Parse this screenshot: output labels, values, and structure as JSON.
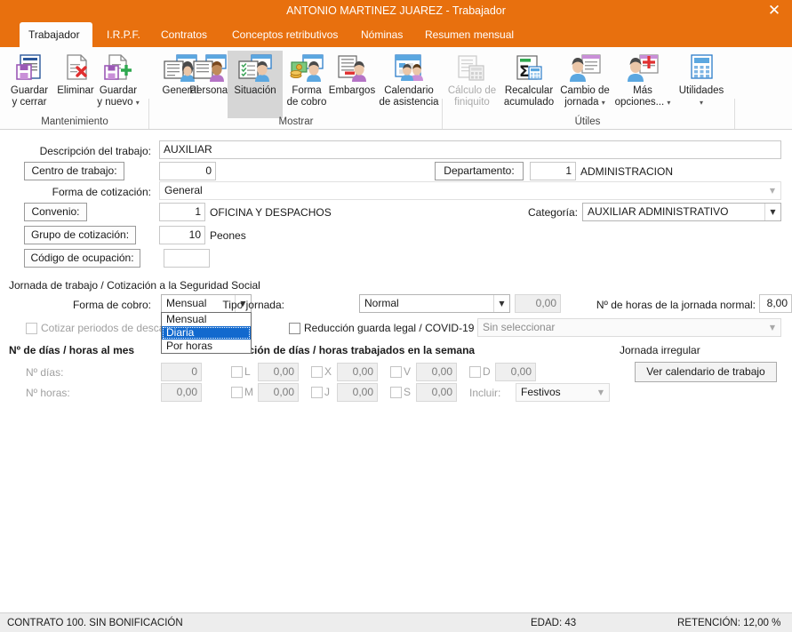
{
  "window": {
    "title": "ANTONIO MARTINEZ JUAREZ - Trabajador",
    "close_icon": "close-icon",
    "accent_color": "#E8700E"
  },
  "tabs": [
    {
      "label": "Trabajador",
      "active": true
    },
    {
      "label": "I.R.P.F.",
      "active": false
    },
    {
      "label": "Contratos",
      "active": false
    },
    {
      "label": "Conceptos retributivos",
      "active": false
    },
    {
      "label": "Nóminas",
      "active": false
    },
    {
      "label": "Resumen mensual",
      "active": false
    }
  ],
  "ribbon": {
    "groups": [
      {
        "label": "Mantenimiento"
      },
      {
        "label": "Mostrar"
      },
      {
        "label": "Útiles"
      }
    ],
    "buttons": [
      {
        "label": "Guardar\ny cerrar",
        "icon": "save-close-icon",
        "selected": false,
        "disabled": false,
        "caret": false
      },
      {
        "label": "Eliminar",
        "icon": "delete-document-icon",
        "selected": false,
        "disabled": false,
        "caret": false
      },
      {
        "label": "Guardar\ny nuevo",
        "icon": "save-new-icon",
        "selected": false,
        "disabled": false,
        "caret": true
      },
      {
        "label": "General",
        "icon": "person-general-icon",
        "selected": false,
        "disabled": false,
        "caret": false
      },
      {
        "label": "Personal",
        "icon": "person-personal-icon",
        "selected": false,
        "disabled": false,
        "caret": false
      },
      {
        "label": "Situación",
        "icon": "person-status-icon",
        "selected": true,
        "disabled": false,
        "caret": false
      },
      {
        "label": "Forma\nde cobro",
        "icon": "person-payment-icon",
        "selected": false,
        "disabled": false,
        "caret": false
      },
      {
        "label": "Embargos",
        "icon": "person-seizure-icon",
        "selected": false,
        "disabled": false,
        "caret": false
      },
      {
        "label": "Calendario\nde asistencia",
        "icon": "calendar-people-icon",
        "selected": false,
        "disabled": false,
        "caret": false
      },
      {
        "label": "Cálculo de\nfiniquito",
        "icon": "settlement-calc-icon",
        "selected": false,
        "disabled": true,
        "caret": false
      },
      {
        "label": "Recalcular\nacumulado",
        "icon": "sigma-recalc-icon",
        "selected": false,
        "disabled": false,
        "caret": false
      },
      {
        "label": "Cambio de\njornada",
        "icon": "person-shift-icon",
        "selected": false,
        "disabled": false,
        "caret": true
      },
      {
        "label": "Más\nopciones...",
        "icon": "person-plus-icon",
        "selected": false,
        "disabled": false,
        "caret": true
      },
      {
        "label": "Utilidades",
        "icon": "calculator-icon",
        "selected": false,
        "disabled": false,
        "caret": true
      }
    ]
  },
  "form": {
    "descripcion_label": "Descripción del trabajo:",
    "descripcion_value": "AUXILIAR",
    "centro_label": "Centro de trabajo:",
    "centro_value": "0",
    "departamento_label": "Departamento:",
    "departamento_value": "1",
    "departamento_text": "ADMINISTRACION",
    "forma_cotizacion_label": "Forma de cotización:",
    "forma_cotizacion_value": "General",
    "convenio_label": "Convenio:",
    "convenio_value": "1",
    "convenio_text": "OFICINA Y DESPACHOS",
    "categoria_label": "Categoría:",
    "categoria_value": "AUXILIAR ADMINISTRATIVO",
    "grupo_label": "Grupo de cotización:",
    "grupo_value": "10",
    "grupo_text": "Peones",
    "ocupacion_label": "Código de ocupación:",
    "ocupacion_value": "",
    "section_jornada": "Jornada de trabajo / Cotización a la Seguridad Social",
    "forma_cobro_label": "Forma de cobro:",
    "forma_cobro_value": "Mensual",
    "forma_cobro_options": [
      "Mensual",
      "Diaria",
      "Por horas"
    ],
    "forma_cobro_highlighted": "Diaria",
    "cotizar_label": "Cotizar periodos de descanso",
    "cotizar_checked": false,
    "tipo_jornada_label": "Tipo jornada:",
    "tipo_jornada_value": "Normal",
    "tipo_jornada_num": "0,00",
    "reduccion_label": "Reducción guarda legal / COVID-19",
    "reduccion_checked": false,
    "reduccion_select": "Sin seleccionar",
    "horas_jornada_label": "Nº de horas de la jornada normal:",
    "horas_jornada_value": "8,00",
    "dias_mes_section": "Nº de días / horas al mes",
    "dias_label": "Nº días:",
    "dias_value": "0",
    "horas_label": "Nº horas:",
    "horas_value": "0,00",
    "semana_section": "Definición de días / horas trabajados en la semana",
    "weekdays": [
      {
        "code": "L",
        "value": "0,00",
        "checked": false
      },
      {
        "code": "M",
        "value": "0,00",
        "checked": false
      },
      {
        "code": "X",
        "value": "0,00",
        "checked": false
      },
      {
        "code": "J",
        "value": "0,00",
        "checked": false
      },
      {
        "code": "V",
        "value": "0,00",
        "checked": false
      },
      {
        "code": "S",
        "value": "0,00",
        "checked": false
      },
      {
        "code": "D",
        "value": "0,00",
        "checked": false
      }
    ],
    "incluir_label": "Incluir:",
    "incluir_value": "Festivos",
    "jornada_irregular_label": "Jornada irregular",
    "ver_calendario_button": "Ver calendario de trabajo"
  },
  "statusbar": {
    "contrato": "CONTRATO 100.  SIN BONIFICACIÓN",
    "edad": "EDAD: 43",
    "retencion": "RETENCIÓN: 12,00 %"
  }
}
